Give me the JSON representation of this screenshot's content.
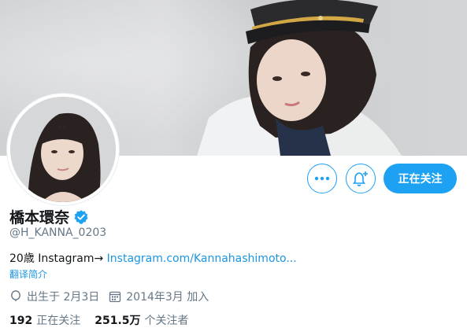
{
  "profile": {
    "name": "橋本環奈",
    "handle": "@H_KANNA_0203",
    "bio_text": "20歳 Instagram→ ",
    "bio_link": "Instagram.com/Kannahashimoto...",
    "translate_label": "翻译简介",
    "birthday": "出生于 2月3日",
    "joined": "2014年3月 加入",
    "following_count": "192",
    "following_label": "正在关注",
    "followers_count": "251.5万",
    "followers_label": "个关注者",
    "verified_icon": "verified-badge-icon"
  },
  "actions": {
    "more_icon": "more-icon",
    "notify_icon": "bell-plus-icon",
    "follow_label": "正在关注"
  },
  "colors": {
    "accent": "#1da1f2",
    "link": "#1b95e0",
    "muted": "#657786"
  }
}
